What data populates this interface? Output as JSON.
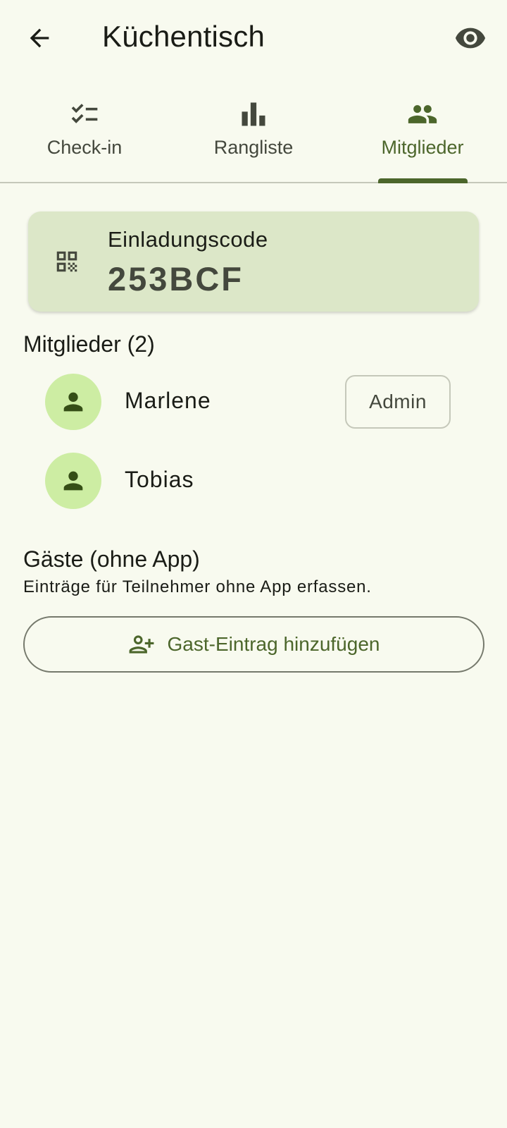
{
  "appbar": {
    "title": "Küchentisch",
    "back_icon": "arrow-left-icon",
    "visibility_icon": "eye-icon"
  },
  "tabs": [
    {
      "label": "Check-in",
      "icon": "checklist-icon",
      "active": false
    },
    {
      "label": "Rangliste",
      "icon": "bar-chart-icon",
      "active": false
    },
    {
      "label": "Mitglieder",
      "icon": "group-icon",
      "active": true
    }
  ],
  "invite": {
    "label": "Einladungscode",
    "code": "253BCF",
    "icon": "qr-code-icon"
  },
  "members": {
    "heading": "Mitglieder (2)",
    "items": [
      {
        "name": "Marlene",
        "badge": "Admin",
        "icon": "person-icon"
      },
      {
        "name": "Tobias",
        "icon": "person-icon"
      }
    ]
  },
  "guests": {
    "heading": "Gäste (ohne App)",
    "subtitle": "Einträge für Teilnehmer ohne App erfassen.",
    "button_label": "Gast-Eintrag hinzufügen",
    "button_icon": "person-add-icon"
  },
  "colors": {
    "background": "#f8faef",
    "primary": "#4c662b",
    "card": "#dce7c8",
    "avatar": "#cdeda3",
    "on_surface": "#1a1c16",
    "on_surface_variant": "#44483d"
  }
}
